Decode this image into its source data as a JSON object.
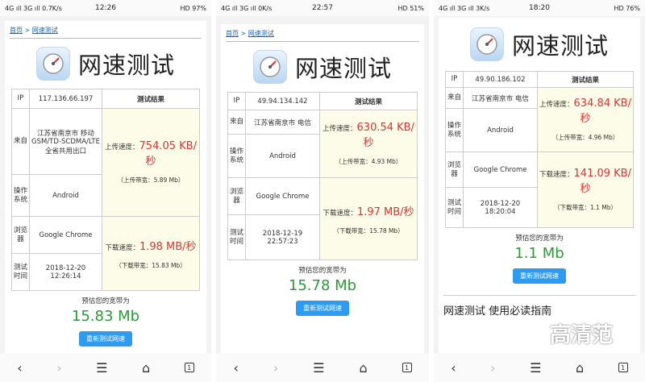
{
  "app_title": "网速测试",
  "breadcrumb": {
    "home": "首页",
    "sep": " > ",
    "current": "网速测试"
  },
  "labels": {
    "ip": "IP",
    "result_header": "测试结果",
    "location": "来自",
    "os": "操作系统",
    "browser": "浏览器",
    "time": "测试时间",
    "upload_speed": "上传速度：",
    "download_speed": "下载速度：",
    "upload_bw": "（上传带宽：",
    "download_bw": "（下载带宽：",
    "estimate": "预估您的宽带为",
    "retest": "重新测试网速",
    "guide": "网速测试 使用必读指南"
  },
  "screens": [
    {
      "status": {
        "left": "4G ıll 3G ıll 0.7K/s",
        "time": "12:26",
        "right": "HD 97%"
      },
      "ip": "117.136.66.197",
      "location": "江苏省南京市 移动GSM/TD-SCDMA/LTE全省共用出口",
      "os": "Android",
      "browser": "Google Chrome",
      "date": "2018-12-20",
      "time": "12:26:14",
      "upload": "754.05 KB/秒",
      "upload_bw": "5.89 Mb）",
      "download": "1.98 MB/秒",
      "download_bw": "15.83 Mb）",
      "estimate": "15.83 Mb"
    },
    {
      "status": {
        "left": "4G ıll 3G ıll 0K/s",
        "time": "22:57",
        "right": "HD 51%"
      },
      "ip": "49.94.134.142",
      "location": "江苏省南京市 电信",
      "os": "Android",
      "browser": "Google Chrome",
      "date": "2018-12-19",
      "time": "22:57:23",
      "upload": "630.54 KB/秒",
      "upload_bw": "4.93 Mb）",
      "download": "1.97 MB/秒",
      "download_bw": "15.78 Mb）",
      "estimate": "15.78 Mb"
    },
    {
      "status": {
        "left": "4G ıll 3G ıll 3K/s",
        "time": "18:20",
        "right": "HD 76%"
      },
      "ip": "49.90.186.102",
      "location": "江苏省南京市 电信",
      "os": "Android",
      "browser": "Google Chrome",
      "date": "2018-12-20",
      "time": "18:20:04",
      "upload": "634.84 KB/秒",
      "upload_bw": "4.96 Mb）",
      "download": "141.09 KB/秒",
      "download_bw": "1.1 Mb）",
      "estimate": "1.1 Mb"
    }
  ],
  "watermark": "高清范"
}
